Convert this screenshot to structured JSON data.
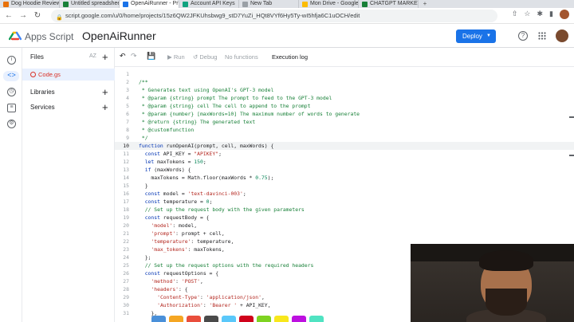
{
  "browser": {
    "tabs": [
      {
        "title": "Dog Hoodie Review",
        "active": false,
        "color": "#e8710a"
      },
      {
        "title": "Untitled spreadsheet",
        "active": false,
        "color": "#188038"
      },
      {
        "title": "OpenAiRunner - Pr",
        "active": true,
        "color": "#1a73e8"
      },
      {
        "title": "Account API Keys",
        "active": false,
        "color": "#10a37f"
      },
      {
        "title": "New Tab",
        "active": false,
        "color": "#9aa0a6"
      },
      {
        "title": "Mon Drive - Google",
        "active": false,
        "color": "#fbbc04"
      },
      {
        "title": "CHATGPT MARKET",
        "active": false,
        "color": "#188038"
      }
    ],
    "new_tab": "+",
    "url": "script.google.com/u/0/home/projects/15z6QW2JFKUhsbwg9_stD7YuZi_HQt8VYf6Hy5Ty-wI5hfja6C1uOCH/edit"
  },
  "header": {
    "product": "Apps Script",
    "project_name": "OpenAiRunner",
    "deploy_label": "Deploy",
    "help_glyph": "?"
  },
  "files_panel": {
    "title": "Files",
    "sort_label": "AZ",
    "files": [
      {
        "name": "Code.gs"
      }
    ],
    "libraries_label": "Libraries",
    "services_label": "Services"
  },
  "toolbar": {
    "run_label": "Run",
    "debug_label": "Debug",
    "no_functions_label": "No functions",
    "execution_log_label": "Execution log"
  },
  "editor": {
    "current_line": 10,
    "lines": [
      {
        "n": "1",
        "text": "",
        "kind": "plain"
      },
      {
        "n": "2",
        "text": "/**",
        "kind": "comment"
      },
      {
        "n": "3",
        "text": " * Generates text using OpenAI's GPT-3 model",
        "kind": "comment"
      },
      {
        "n": "4",
        "text": " * @param {string} prompt The prompt to feed to the GPT-3 model",
        "kind": "comment"
      },
      {
        "n": "5",
        "text": " * @param {string} cell The cell to append to the prompt",
        "kind": "comment"
      },
      {
        "n": "6",
        "text": " * @param {number} [maxWords=10] The maximum number of words to generate",
        "kind": "comment"
      },
      {
        "n": "7",
        "text": " * @return {string} The generated text",
        "kind": "comment"
      },
      {
        "n": "8",
        "text": " * @customfunction",
        "kind": "comment"
      },
      {
        "n": "9",
        "text": " */",
        "kind": "comment"
      },
      {
        "n": "10",
        "text": "function runOpenAI(prompt, cell, maxWords) {",
        "kind": "code"
      },
      {
        "n": "11",
        "text": "  const API_KEY = \"APIKEY\";",
        "kind": "code"
      },
      {
        "n": "12",
        "text": "  let maxTokens = 150;",
        "kind": "code"
      },
      {
        "n": "13",
        "text": "  if (maxWords) {",
        "kind": "code"
      },
      {
        "n": "14",
        "text": "    maxTokens = Math.floor(maxWords * 0.75);",
        "kind": "code"
      },
      {
        "n": "15",
        "text": "  }",
        "kind": "code"
      },
      {
        "n": "16",
        "text": "  const model = 'text-davinci-003';",
        "kind": "code"
      },
      {
        "n": "17",
        "text": "  const temperature = 0;",
        "kind": "code"
      },
      {
        "n": "18",
        "text": "  // Set up the request body with the given parameters",
        "kind": "comment"
      },
      {
        "n": "19",
        "text": "  const requestBody = {",
        "kind": "code"
      },
      {
        "n": "20",
        "text": "    'model': model,",
        "kind": "code"
      },
      {
        "n": "21",
        "text": "    'prompt': prompt + cell,",
        "kind": "code"
      },
      {
        "n": "22",
        "text": "    'temperature': temperature,",
        "kind": "code"
      },
      {
        "n": "23",
        "text": "    'max_tokens': maxTokens,",
        "kind": "code"
      },
      {
        "n": "24",
        "text": "  };",
        "kind": "code"
      },
      {
        "n": "25",
        "text": "  // Set up the request options with the required headers",
        "kind": "comment"
      },
      {
        "n": "26",
        "text": "  const requestOptions = {",
        "kind": "code"
      },
      {
        "n": "27",
        "text": "    'method': 'POST',",
        "kind": "code"
      },
      {
        "n": "28",
        "text": "    'headers': {",
        "kind": "code"
      },
      {
        "n": "29",
        "text": "      'Content-Type': 'application/json',",
        "kind": "code"
      },
      {
        "n": "30",
        "text": "      'Authorization': 'Bearer ' + API_KEY,",
        "kind": "code"
      },
      {
        "n": "31",
        "text": "    },",
        "kind": "code"
      }
    ]
  },
  "colors": {
    "accent": "#1a73e8",
    "comment": "#188038",
    "keyword": "#0033b3",
    "string": "#b3261e",
    "number": "#098658",
    "active_file": "#d93025"
  }
}
